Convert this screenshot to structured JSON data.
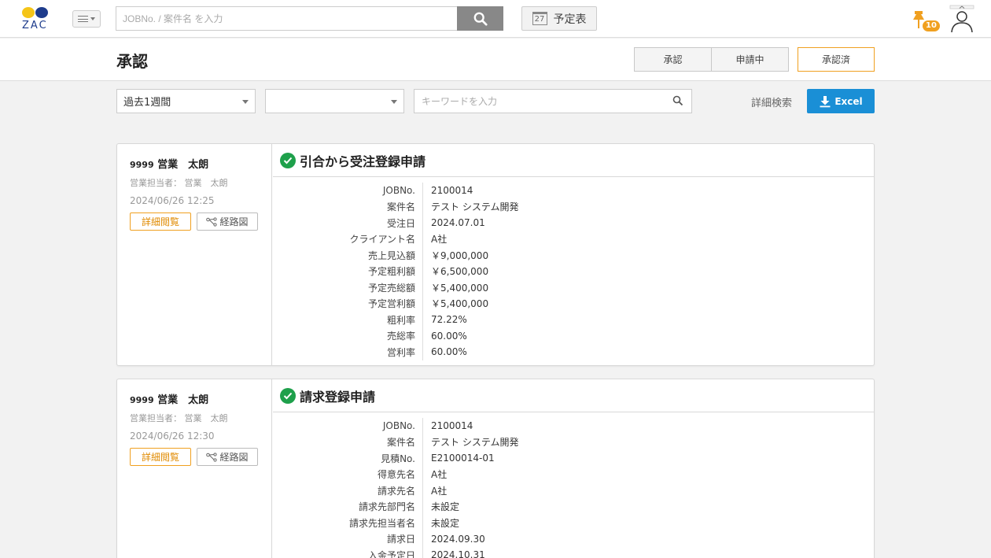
{
  "header": {
    "logo_text": "ZAC",
    "search_placeholder": "JOBNo. / 案件名 を入力",
    "schedule_label": "予定表",
    "schedule_day": "27",
    "pin_count": "10"
  },
  "page": {
    "title": "承認",
    "segments": [
      "承認",
      "申請中",
      "承認済"
    ]
  },
  "filters": {
    "period": "過去1週間",
    "second_select": "",
    "keyword_placeholder": "キーワードを入力",
    "advanced_search": "詳細検索",
    "excel_label": "Excel"
  },
  "cards": [
    {
      "name_num": "9999",
      "name": "営業　太朗",
      "owner": "営業担当者：  営業　太朗",
      "date": "2024/06/26 12:25",
      "detail_btn": "詳細閲覧",
      "route_btn": "経路図",
      "title": "引合から受注登録申請",
      "rows": [
        {
          "k": "JOBNo.",
          "v": "2100014"
        },
        {
          "k": "案件名",
          "v": "テスト システム開発"
        },
        {
          "k": "受注日",
          "v": "2024.07.01"
        },
        {
          "k": "クライアント名",
          "v": "A社"
        },
        {
          "k": "売上見込額",
          "v": "￥9,000,000"
        },
        {
          "k": "予定粗利額",
          "v": "￥6,500,000"
        },
        {
          "k": "予定売総額",
          "v": "￥5,400,000"
        },
        {
          "k": "予定営利額",
          "v": "￥5,400,000"
        },
        {
          "k": "粗利率",
          "v": "72.22%"
        },
        {
          "k": "売総率",
          "v": "60.00%"
        },
        {
          "k": "営利率",
          "v": "60.00%"
        }
      ]
    },
    {
      "name_num": "9999",
      "name": "営業　太朗",
      "owner": "営業担当者：  営業　太朗",
      "date": "2024/06/26 12:30",
      "detail_btn": "詳細閲覧",
      "route_btn": "経路図",
      "title": "請求登録申請",
      "rows": [
        {
          "k": "JOBNo.",
          "v": "2100014"
        },
        {
          "k": "案件名",
          "v": "テスト システム開発"
        },
        {
          "k": "見積No.",
          "v": "E2100014-01"
        },
        {
          "k": "得意先名",
          "v": "A社"
        },
        {
          "k": "請求先名",
          "v": "A社"
        },
        {
          "k": "請求先部門名",
          "v": "未設定"
        },
        {
          "k": "請求先担当者名",
          "v": "未設定"
        },
        {
          "k": "請求日",
          "v": "2024.09.30"
        },
        {
          "k": "入金予定日",
          "v": "2024.10.31"
        }
      ]
    }
  ]
}
